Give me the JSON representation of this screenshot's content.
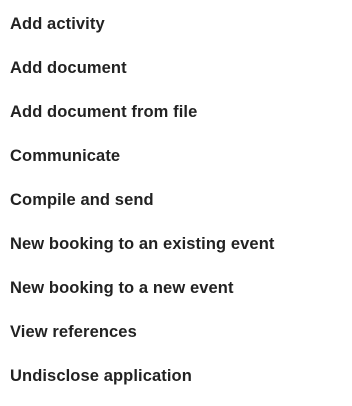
{
  "menu": {
    "items": [
      {
        "label": "Add activity"
      },
      {
        "label": "Add document"
      },
      {
        "label": "Add document from file"
      },
      {
        "label": "Communicate"
      },
      {
        "label": "Compile and send"
      },
      {
        "label": "New booking to an existing event"
      },
      {
        "label": "New booking to a new event"
      },
      {
        "label": "View references"
      },
      {
        "label": "Undisclose application"
      }
    ]
  }
}
